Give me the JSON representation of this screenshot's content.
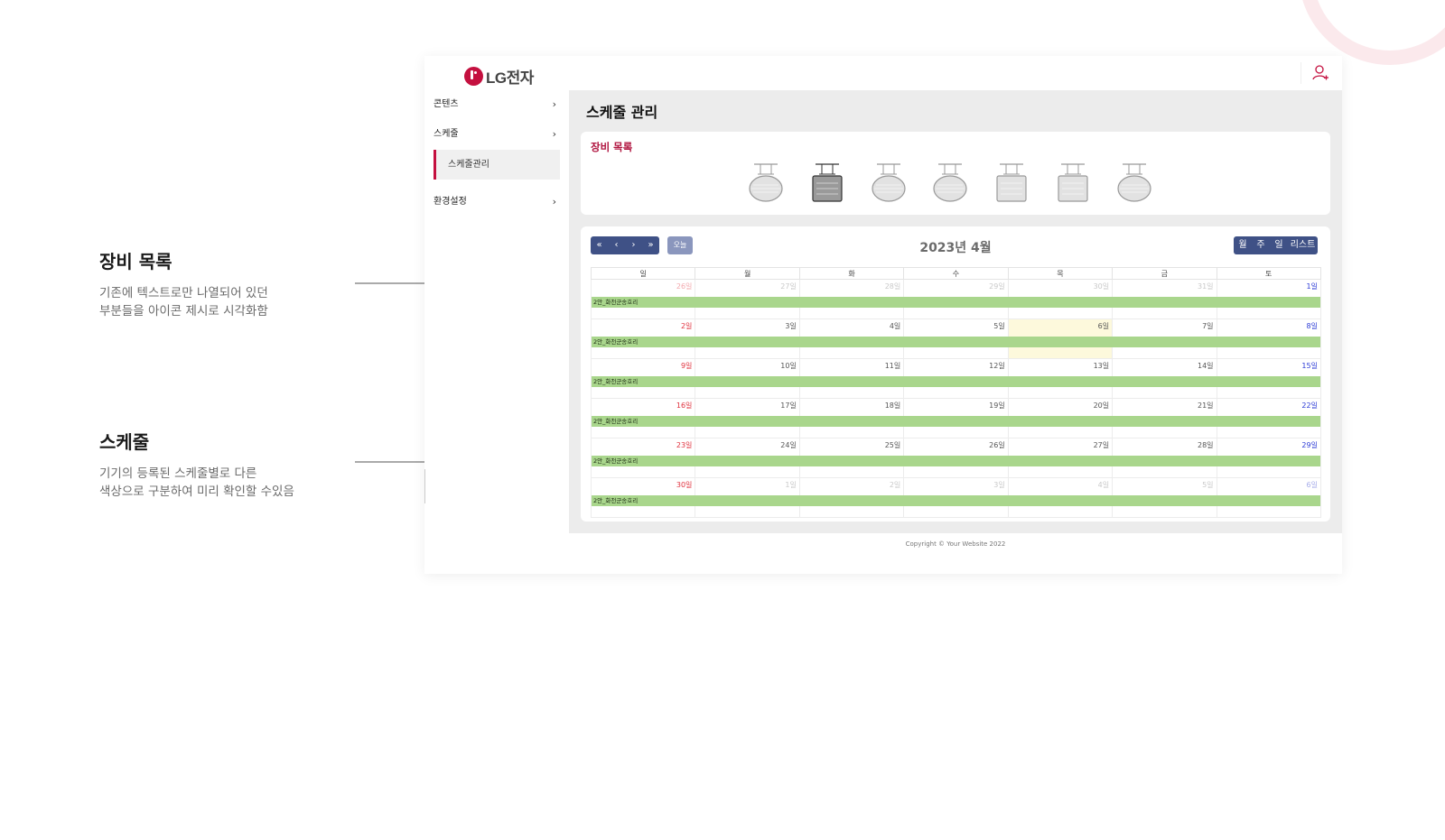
{
  "annotations": [
    {
      "title": "장비 목록",
      "lines": [
        "기존에 텍스트로만 나열되어 있던",
        "부분들을 아이콘 제시로 시각화함"
      ]
    },
    {
      "title": "스케줄",
      "lines": [
        "기기의 등록된 스케줄별로 다른",
        "색상으로 구분하여 미리 확인할 수있음"
      ]
    }
  ],
  "app": {
    "logo_text": "LG전자",
    "icons": {
      "user": "user-add-icon"
    },
    "colors": {
      "brand": "#c4103f",
      "nav_button": "#3f5186",
      "event_bar": "#a9d68c",
      "today_cell": "#fdf9dc"
    }
  },
  "sidebar": {
    "items": [
      {
        "label": "콘텐츠"
      },
      {
        "label": "스케줄"
      },
      {
        "label": "환경설정"
      }
    ],
    "submenu": {
      "label": "스케줄관리",
      "active": true
    }
  },
  "page": {
    "title": "스케줄 관리"
  },
  "devices": {
    "title": "장비 목록",
    "items": [
      {
        "shape": "round-sign-icon",
        "selected": false
      },
      {
        "shape": "square-sign-icon",
        "selected": true
      },
      {
        "shape": "round-sign-icon",
        "selected": false
      },
      {
        "shape": "round-sign-icon",
        "selected": false
      },
      {
        "shape": "square-sign-icon",
        "selected": false
      },
      {
        "shape": "square-sign-icon",
        "selected": false
      },
      {
        "shape": "round-sign-icon",
        "selected": false
      }
    ]
  },
  "calendar": {
    "month_label": "2023년 4월",
    "nav_buttons": [
      "«",
      "‹",
      "›",
      "»"
    ],
    "today_label": "오늘",
    "view_buttons": [
      "월",
      "주",
      "일",
      "리스트"
    ],
    "weekdays": [
      "일",
      "월",
      "화",
      "수",
      "목",
      "금",
      "토"
    ],
    "weeks": [
      {
        "days": [
          {
            "d": "26일",
            "o": true
          },
          {
            "d": "27일",
            "o": true
          },
          {
            "d": "28일",
            "o": true
          },
          {
            "d": "29일",
            "o": true
          },
          {
            "d": "30일",
            "o": true
          },
          {
            "d": "31일",
            "o": true
          },
          {
            "d": "1일"
          }
        ],
        "event": "2안_화천군송호리"
      },
      {
        "days": [
          {
            "d": "2일"
          },
          {
            "d": "3일"
          },
          {
            "d": "4일"
          },
          {
            "d": "5일"
          },
          {
            "d": "6일",
            "today": true
          },
          {
            "d": "7일"
          },
          {
            "d": "8일"
          }
        ],
        "event": "2안_화천군송호리"
      },
      {
        "days": [
          {
            "d": "9일"
          },
          {
            "d": "10일"
          },
          {
            "d": "11일"
          },
          {
            "d": "12일"
          },
          {
            "d": "13일"
          },
          {
            "d": "14일"
          },
          {
            "d": "15일"
          }
        ],
        "event": "2안_화천군송호리"
      },
      {
        "days": [
          {
            "d": "16일"
          },
          {
            "d": "17일"
          },
          {
            "d": "18일"
          },
          {
            "d": "19일"
          },
          {
            "d": "20일"
          },
          {
            "d": "21일"
          },
          {
            "d": "22일"
          }
        ],
        "event": "2안_화천군송호리"
      },
      {
        "days": [
          {
            "d": "23일"
          },
          {
            "d": "24일"
          },
          {
            "d": "25일"
          },
          {
            "d": "26일"
          },
          {
            "d": "27일"
          },
          {
            "d": "28일"
          },
          {
            "d": "29일"
          }
        ],
        "event": "2안_화천군송호리"
      },
      {
        "days": [
          {
            "d": "30일"
          },
          {
            "d": "1일",
            "o": true
          },
          {
            "d": "2일",
            "o": true
          },
          {
            "d": "3일",
            "o": true
          },
          {
            "d": "4일",
            "o": true
          },
          {
            "d": "5일",
            "o": true
          },
          {
            "d": "6일",
            "o": true
          }
        ],
        "event": "2안_화천군송호리"
      }
    ]
  },
  "footer": {
    "text": "Copyright © Your Website 2022"
  }
}
